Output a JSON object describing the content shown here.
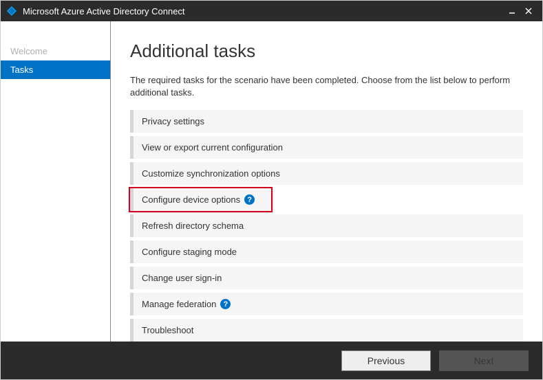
{
  "window": {
    "title": "Microsoft Azure Active Directory Connect"
  },
  "sidebar": {
    "items": [
      {
        "label": "Welcome",
        "active": false
      },
      {
        "label": "Tasks",
        "active": true
      }
    ]
  },
  "main": {
    "title": "Additional tasks",
    "description": "The required tasks for the scenario have been completed. Choose from the list below to perform additional tasks.",
    "tasks": [
      {
        "label": "Privacy settings",
        "help": false,
        "highlighted": false
      },
      {
        "label": "View or export current configuration",
        "help": false,
        "highlighted": false
      },
      {
        "label": "Customize synchronization options",
        "help": false,
        "highlighted": false
      },
      {
        "label": "Configure device options",
        "help": true,
        "highlighted": true
      },
      {
        "label": "Refresh directory schema",
        "help": false,
        "highlighted": false
      },
      {
        "label": "Configure staging mode",
        "help": false,
        "highlighted": false
      },
      {
        "label": "Change user sign-in",
        "help": false,
        "highlighted": false
      },
      {
        "label": "Manage federation",
        "help": true,
        "highlighted": false
      },
      {
        "label": "Troubleshoot",
        "help": false,
        "highlighted": false
      }
    ]
  },
  "footer": {
    "previous": "Previous",
    "next": "Next"
  }
}
